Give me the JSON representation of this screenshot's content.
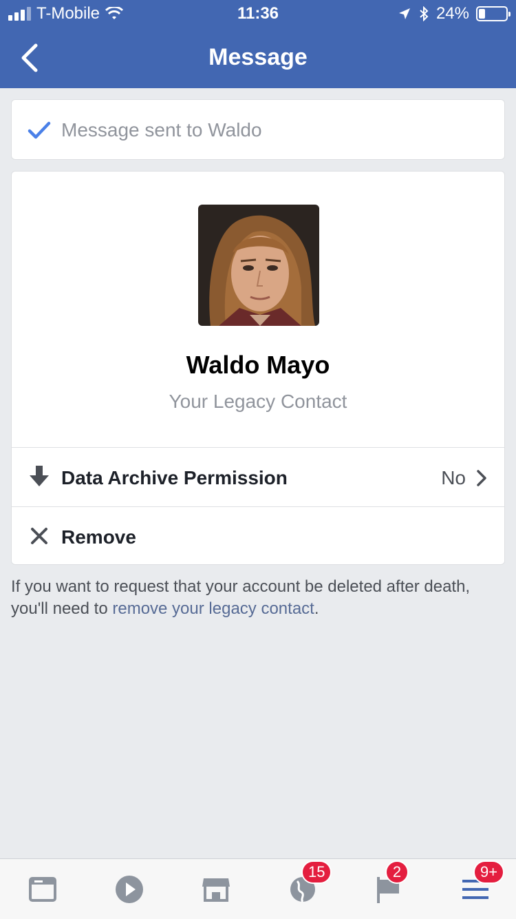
{
  "status_bar": {
    "carrier": "T-Mobile",
    "time": "11:36",
    "battery": "24%",
    "battery_level": 0.24
  },
  "nav": {
    "title": "Message"
  },
  "confirmation": {
    "text": "Message sent to Waldo"
  },
  "profile": {
    "name": "Waldo Mayo",
    "subtitle": "Your Legacy Contact"
  },
  "rows": {
    "archive_label": "Data Archive Permission",
    "archive_value": "No",
    "remove_label": "Remove"
  },
  "footnote": {
    "text": "If you want to request that your account be deleted after death, you'll need to ",
    "link": "remove your legacy contact",
    "end": "."
  },
  "tabbar": {
    "badges": {
      "notifications": "15",
      "groups": "2",
      "menu": "9+"
    }
  },
  "colors": {
    "brand": "#4267b2",
    "badge": "#e41e3f",
    "link": "#576b95"
  }
}
